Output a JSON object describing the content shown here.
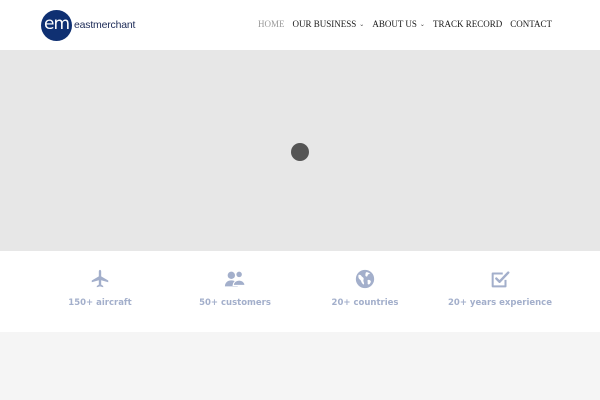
{
  "brand": {
    "mark": "em",
    "name": "eastmerchant"
  },
  "nav": {
    "items": [
      {
        "label": "HOME",
        "active": true,
        "dropdown": false
      },
      {
        "label": "OUR BUSINESS",
        "active": false,
        "dropdown": true
      },
      {
        "label": "ABOUT US",
        "active": false,
        "dropdown": true
      },
      {
        "label": "TRACK RECORD",
        "active": false,
        "dropdown": false
      },
      {
        "label": "CONTACT",
        "active": false,
        "dropdown": false
      }
    ],
    "caret": "⌄"
  },
  "stats": [
    {
      "icon": "airplane-icon",
      "label": "150+ aircraft"
    },
    {
      "icon": "customers-icon",
      "label": "50+ customers"
    },
    {
      "icon": "globe-icon",
      "label": "20+ countries"
    },
    {
      "icon": "checkbox-icon",
      "label": "20+ years experience"
    }
  ],
  "colors": {
    "brand": "#0f3072",
    "stat_icon": "#a3afcb",
    "hero_bg": "#e7e7e7",
    "spinner": "#555555"
  }
}
